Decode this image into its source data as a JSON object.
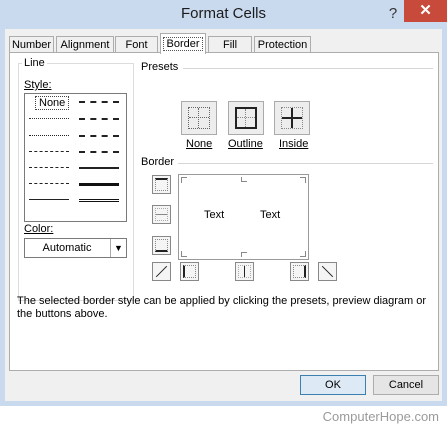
{
  "window": {
    "title": "Format Cells",
    "help": "?",
    "close": "✕"
  },
  "tabs": [
    {
      "label": "Number"
    },
    {
      "label": "Alignment"
    },
    {
      "label": "Font"
    },
    {
      "label": "Border",
      "active": true
    },
    {
      "label": "Fill"
    },
    {
      "label": "Protection"
    }
  ],
  "line": {
    "group_label": "Line",
    "style_label": "Style:",
    "none_label": "None",
    "color_label": "Color:",
    "color_value": "Automatic"
  },
  "presets": {
    "label": "Presets",
    "buttons": [
      {
        "label": "None"
      },
      {
        "label": "Outline"
      },
      {
        "label": "Inside"
      }
    ]
  },
  "border": {
    "label": "Border",
    "preview_texts": [
      "Text",
      "Text"
    ]
  },
  "description": "The selected border style can be applied by clicking the presets, preview diagram or the buttons above.",
  "buttons": {
    "ok": "OK",
    "cancel": "Cancel"
  },
  "watermark": "ComputerHope.com",
  "colors": {
    "titlebar": "#c9daef",
    "close": "#c74a3a",
    "default_button_border": "#3c7fb1"
  }
}
